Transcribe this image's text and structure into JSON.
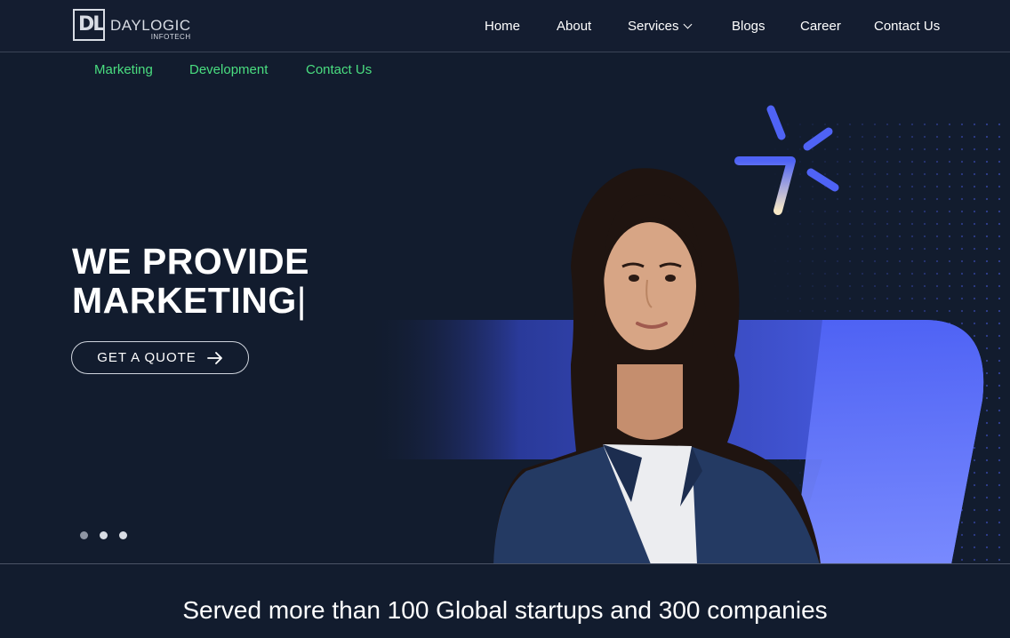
{
  "brand": {
    "logo_letters": "DL",
    "name": "DAYLOGIC",
    "sub": "INFOTECH"
  },
  "nav": {
    "home": "Home",
    "about": "About",
    "services": "Services",
    "blogs": "Blogs",
    "career": "Career",
    "contact": "Contact Us"
  },
  "subnav": {
    "marketing": "Marketing",
    "development": "Development",
    "contact": "Contact Us"
  },
  "hero": {
    "line1": "WE PROVIDE",
    "line2": "MARKETING",
    "caret": "|",
    "cta": "GET A QUOTE",
    "slide_count": 3,
    "active_slide": 1
  },
  "tagline": "Served more than 100 Global startups and 300 companies",
  "colors": {
    "background": "#121c2e",
    "accent_blue": "#4f63f5",
    "subnav_green": "#4ade80"
  },
  "icons": [
    "chevron-down-icon",
    "arrow-right-icon",
    "sparkle-icon"
  ]
}
